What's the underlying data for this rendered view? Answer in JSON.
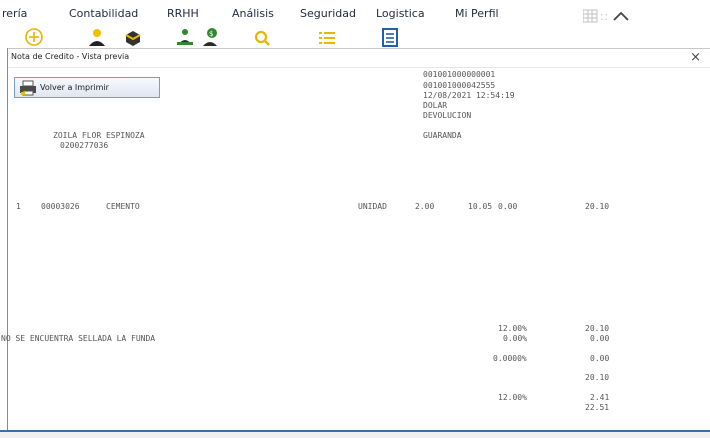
{
  "menu": [
    "rería",
    "Contabilidad",
    "RRHH",
    "Análisis",
    "Seguridad",
    "Logistica",
    "Mi Perfil"
  ],
  "toolbar_icons": [
    "add-icon",
    "user-icon",
    "box-icon",
    "person-down-icon",
    "money-person-icon",
    "search-icon",
    "list-icon",
    "document-icon"
  ],
  "dialog": {
    "title": "Nota de Credito - Vista previa",
    "close": "×",
    "reprint_label": "Volver a Imprimir"
  },
  "header": {
    "line1": "001001000000001",
    "line2": "001001000042555",
    "date": "12/08/2021 12:54:19",
    "currency": "DOLAR",
    "type": "DEVOLUCION"
  },
  "client": {
    "name": "ZOILA FLOR ESPINOZA",
    "id": "0200277036",
    "city": "GUARANDA"
  },
  "items": [
    {
      "line": "1",
      "code": "00003026",
      "desc": "CEMENTO",
      "unit": "UNIDAD",
      "qty": "2.00",
      "price": "10.05",
      "disc": "0.00",
      "total": "20.10"
    }
  ],
  "note": "NO SE ENCUENTRA SELLADA LA FUNDA",
  "totals": {
    "r1_pct": "12.00%",
    "r1_val": "20.10",
    "r2_pct": "0.00%",
    "r2_val": "0.00",
    "r3_pct": "0.0000%",
    "r3_val": "0.00",
    "r4_val": "20.10",
    "r5_pct": "12.00%",
    "r5_val": "2.41",
    "r6_val": "22.51"
  }
}
